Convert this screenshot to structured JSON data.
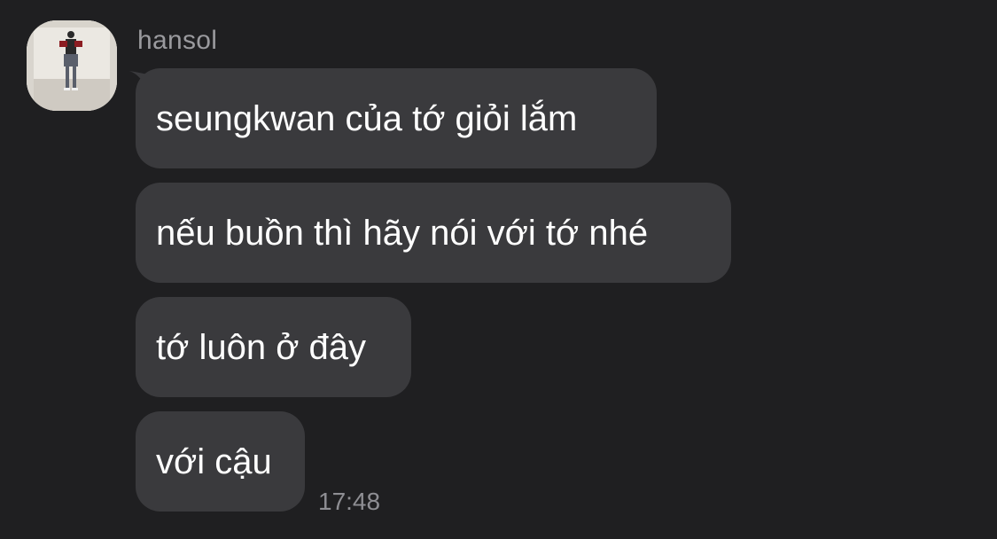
{
  "chat": {
    "sender_name": "hansol",
    "messages": [
      {
        "text": "seungkwan của tớ giỏi lắm"
      },
      {
        "text": "nếu buồn thì hãy nói với tớ nhé"
      },
      {
        "text": "tớ luôn ở đây"
      },
      {
        "text": "với cậu"
      }
    ],
    "timestamp": "17:48"
  },
  "colors": {
    "background": "#1f1f21",
    "bubble": "#3a3a3d",
    "text": "#ffffff",
    "meta_text": "#9a9a9e"
  }
}
